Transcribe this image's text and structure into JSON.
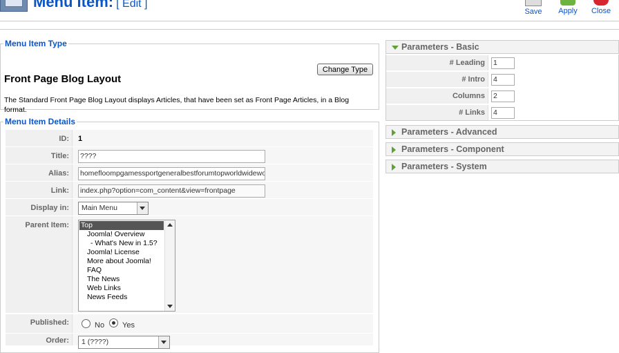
{
  "header": {
    "title": "Menu Item:",
    "subtitle": "[ Edit ]"
  },
  "toolbar": {
    "save_label": "Save",
    "apply_label": "Apply",
    "close_label": "Close"
  },
  "menu_item_type": {
    "legend": "Menu Item Type",
    "change_type_label": "Change Type",
    "layout_title": "Front Page Blog Layout",
    "description": "The Standard Front Page Blog Layout displays Articles, that have been set as Front Page Articles, in a Blog format."
  },
  "details": {
    "legend": "Menu Item Details",
    "id_label": "ID:",
    "id_value": "1",
    "title_label": "Title:",
    "title_value": "????",
    "alias_label": "Alias:",
    "alias_value": "homefloompgamessportgeneralbestforumtopworldwideworld",
    "link_label": "Link:",
    "link_value": "index.php?option=com_content&view=frontpage",
    "display_in_label": "Display in:",
    "display_in_value": "Main Menu",
    "parent_label": "Parent Item:",
    "parent_options": [
      {
        "label": "Top",
        "selected": true,
        "level": 0
      },
      {
        "label": "Joomla! Overview",
        "level": 1
      },
      {
        "label": "- What's New in 1.5?",
        "level": 2
      },
      {
        "label": "Joomla! License",
        "level": 1
      },
      {
        "label": "More about Joomla!",
        "level": 1
      },
      {
        "label": "FAQ",
        "level": 1
      },
      {
        "label": "The News",
        "level": 1
      },
      {
        "label": "Web Links",
        "level": 1
      },
      {
        "label": "News Feeds",
        "level": 1
      }
    ],
    "published_label": "Published:",
    "published_no": "No",
    "published_yes": "Yes",
    "published_value": "Yes",
    "order_label": "Order:",
    "order_value": "1 (????)"
  },
  "params": {
    "basic_title": "Parameters - Basic",
    "advanced_title": "Parameters - Advanced",
    "component_title": "Parameters - Component",
    "system_title": "Parameters - System",
    "leading_label": "# Leading",
    "leading_value": "1",
    "intro_label": "# Intro",
    "intro_value": "4",
    "columns_label": "Columns",
    "columns_value": "2",
    "links_label": "# Links",
    "links_value": "4"
  }
}
